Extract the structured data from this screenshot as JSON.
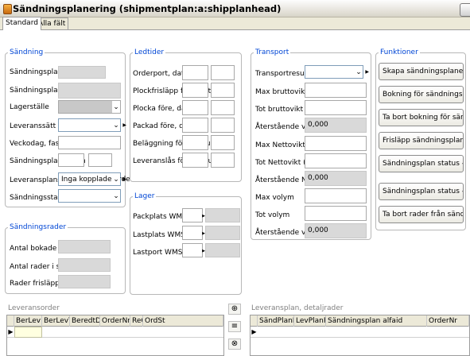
{
  "window": {
    "title": "Sändningsplanering (shipmentplan:a:shipplanhead)"
  },
  "tabs": [
    "Standard",
    "Alla fält"
  ],
  "sandning": {
    "title": "Sändning",
    "labels": [
      "Sändningsplan nr",
      "Sändningsplan alfaid",
      "Lagerställe",
      "Leveranssätt",
      "Veckodag, fast avgång",
      "Sändningsplandatum",
      "Leveransplanstatus",
      "Sändningsstatus"
    ],
    "leveransplanstatus_value": "Inga kopplade order"
  },
  "ledtider": {
    "title": "Ledtider",
    "labels": [
      "Orderport, datum",
      "Plockfrisläpp före, datum",
      "Plocka före, datum",
      "Packad före, datum",
      "Beläggning före, datum",
      "Leveranslås före, datum"
    ]
  },
  "transport": {
    "title": "Transport",
    "labels": [
      "Transportresurs",
      "Max bruttovikt (kg)",
      "Tot bruttovikt (kg)",
      "Återstående vikt (kg)",
      "Max Nettovikt (kg)",
      "Tot Nettovikt (kg)",
      "Återstående Nettovikt (kg)",
      "Max volym",
      "Tot volym",
      "Återstående volym (kg)"
    ],
    "aterstaende_vikt": "0,000",
    "aterstaende_nettovikt": "0,000",
    "aterstaende_volym": "0,000"
  },
  "funktioner": {
    "title": "Funktioner",
    "buttons": [
      "Skapa sändningsplaner",
      "Bokning för sändningsplan",
      "Ta bort bokning för sändningspla",
      "Frisläpp sändningsplan --> WMS",
      "Sändningsplan status --> Packad",
      "Sändningsplan status --> Avsluta",
      "Ta bort rader från sändningsplan"
    ]
  },
  "sandningsrader": {
    "title": "Sändningsrader",
    "labels": [
      "Antal bokade lev.order",
      "Antal rader i sändn.plan",
      "Rader frisläppta till WMS"
    ]
  },
  "lager": {
    "title": "Lager",
    "labels": [
      "Packplats WMS",
      "Lastplats WMS",
      "Lastport WMS"
    ]
  },
  "leveransorder": {
    "title": "Leveransorder",
    "columns": [
      "BerLevDat",
      "BerLevTid",
      "BeredtDat",
      "OrderNr",
      "ReOrd",
      "OrdSt"
    ]
  },
  "detaljrader": {
    "title": "Leveransplan, detaljrader",
    "columns": [
      "SändPlanNr",
      "LevPlanRadNr",
      "Sändningsplan alfaid",
      "OrderNr"
    ]
  },
  "colors": {
    "group_title": "#0046d5",
    "readonly": "#d9d9d9",
    "selected_row": "#ffffe0"
  }
}
